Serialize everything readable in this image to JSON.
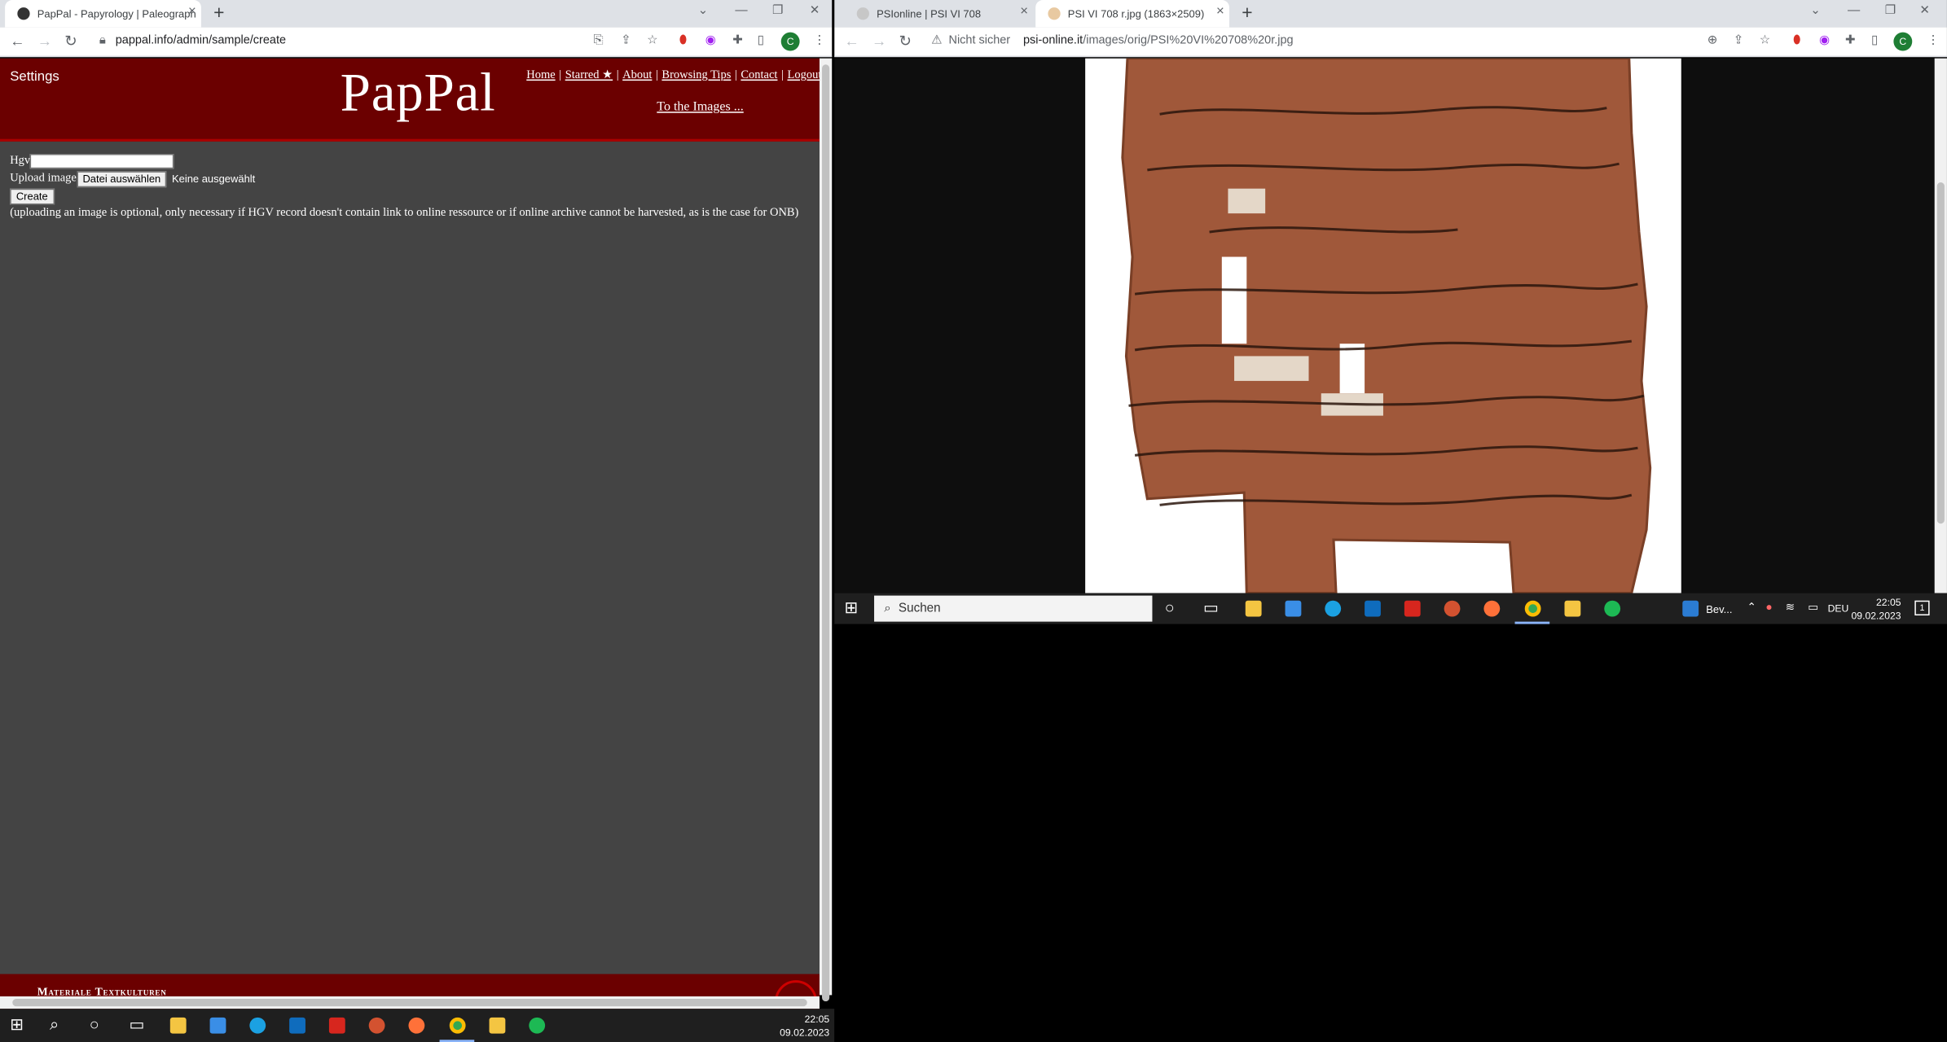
{
  "left_window": {
    "tab_title": "PapPal - Papyrology | Paleograph",
    "url": "pappal.info/admin/sample/create"
  },
  "right_window": {
    "tab1_title": "PSIonline | PSI VI 708",
    "tab2_title": "PSI VI 708 r.jpg (1863×2509)",
    "not_secure_label": "Nicht sicher",
    "url_host": "psi-online.it",
    "url_path": "/images/orig/PSI%20VI%20708%20r.jpg"
  },
  "pappal": {
    "settings": "Settings",
    "logo": "PapPal",
    "menu": [
      "Home",
      "Starred ★",
      "About",
      "Browsing Tips",
      "Contact",
      "Logout"
    ],
    "to_images": "To the Images ...",
    "hgv_label": "Hgv",
    "hgv_value": "",
    "upload_label": "Upload image",
    "file_button": "Datei auswählen",
    "file_status": "Keine ausgewählt",
    "create_button": "Create",
    "note": "(uploading an image is optional, only necessary if HGV record doesn't contain link to online ressource or if online archive cannot be harvested, as is the case for ONB)",
    "footer": "Materiale Textkulturen"
  },
  "taskbar_left": {
    "time": "22:05",
    "date": "09.02.2023"
  },
  "taskbar_right": {
    "search": "Suchen",
    "app_label": "Bev...",
    "lang": "DEU",
    "time": "22:05",
    "date": "09.02.2023",
    "notifications": "1"
  },
  "colors": {
    "pappal_header": "#6b0000",
    "pappal_body": "#444444",
    "papyrus": "#a0583a"
  }
}
